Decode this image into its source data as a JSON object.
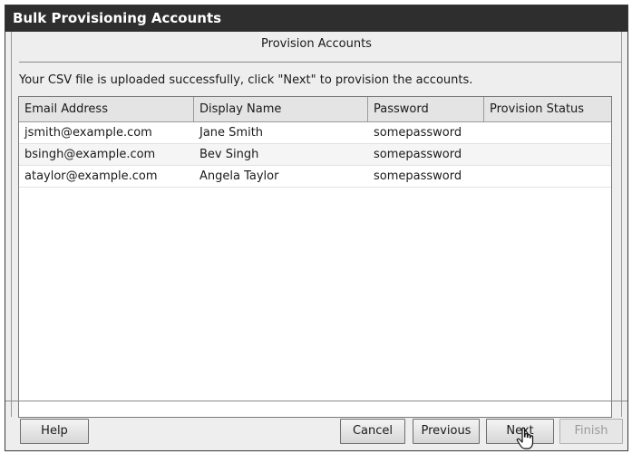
{
  "window": {
    "title": "Bulk Provisioning Accounts"
  },
  "step": {
    "title": "Provision Accounts"
  },
  "message": "Your CSV file is uploaded successfully, click \"Next\" to provision the accounts.",
  "table": {
    "columns": [
      "Email Address",
      "Display Name",
      "Password",
      "Provision Status"
    ],
    "rows": [
      {
        "email": "jsmith@example.com",
        "name": "Jane Smith",
        "password": "somepassword",
        "status": ""
      },
      {
        "email": "bsingh@example.com",
        "name": "Bev Singh",
        "password": "somepassword",
        "status": ""
      },
      {
        "email": "ataylor@example.com",
        "name": "Angela Taylor",
        "password": "somepassword",
        "status": ""
      }
    ]
  },
  "buttons": {
    "help": "Help",
    "cancel": "Cancel",
    "previous": "Previous",
    "next": "Next",
    "finish": "Finish"
  },
  "cursor_icon": "hand-pointer-icon"
}
